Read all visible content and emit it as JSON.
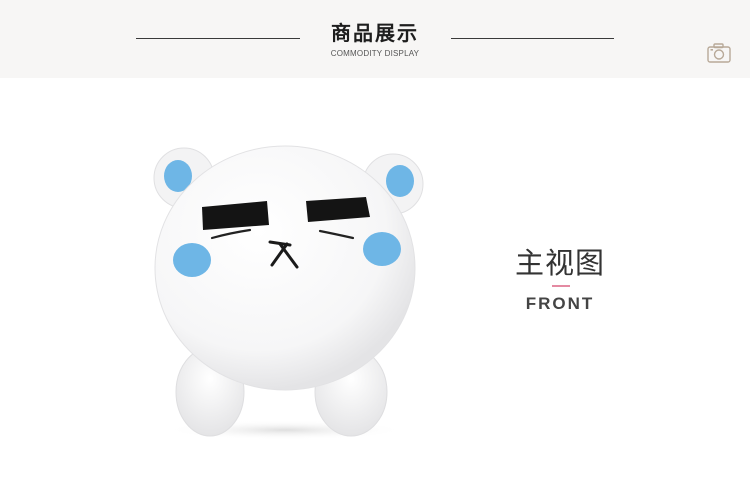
{
  "header": {
    "title": "商品展示",
    "subtitle": "COMMODITY DISPLAY",
    "camera_icon": "camera-icon"
  },
  "product": {
    "photo_subject": "white polar bear plush",
    "view_title": "主视图",
    "view_subtitle": "FRONT"
  },
  "colors": {
    "header_background": "#f7f6f5",
    "accent_pink": "#e48aa2",
    "ear_cheek_blue": "#6eb6e6"
  }
}
